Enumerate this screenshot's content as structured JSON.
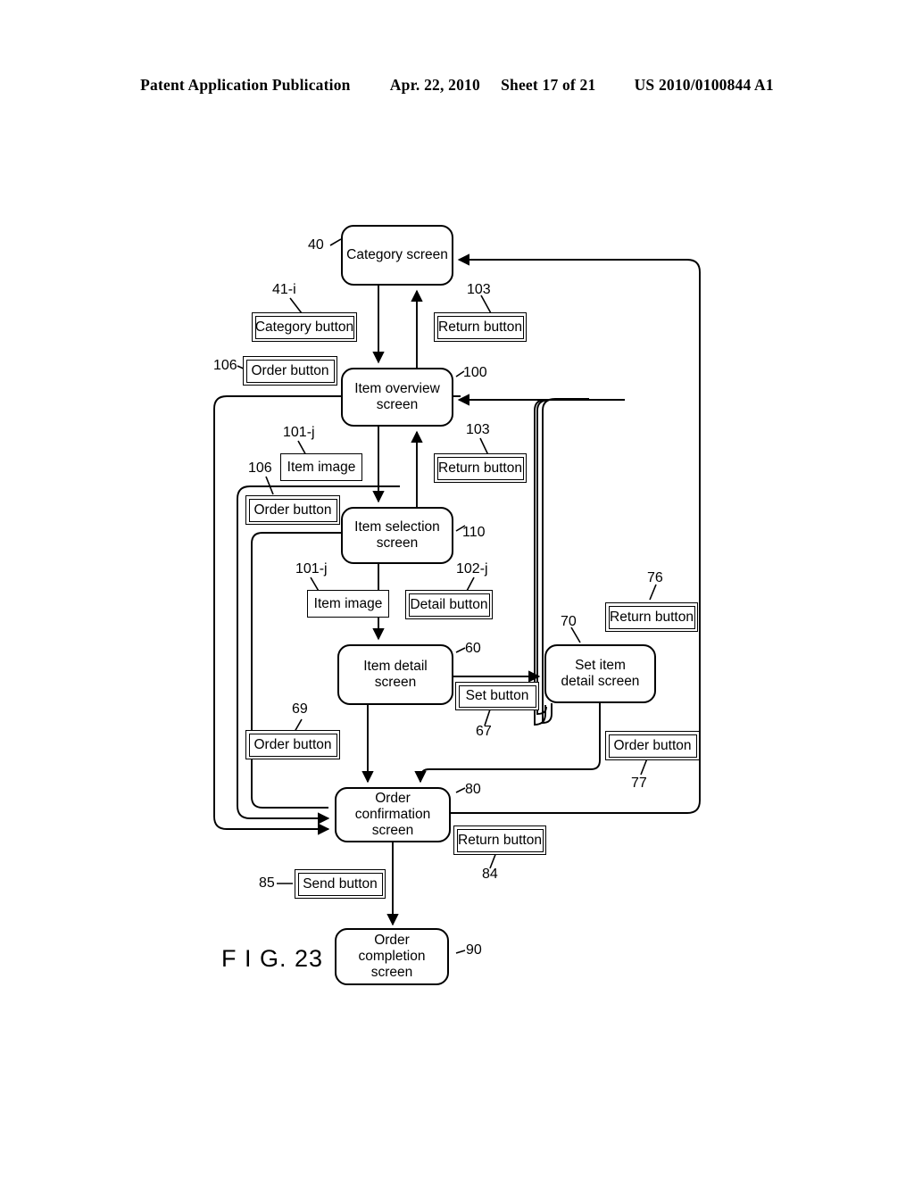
{
  "header": {
    "publication": "Patent Application Publication",
    "date": "Apr. 22, 2010",
    "sheet": "Sheet 17 of 21",
    "docnum": "US 2010/0100844 A1"
  },
  "figure": {
    "caption": "F I G. 23",
    "type": "screen-transition-diagram",
    "nodes": [
      {
        "id": "n40",
        "ref": "40",
        "label": "Category screen"
      },
      {
        "id": "n100",
        "ref": "100",
        "label": "Item overview\nscreen",
        "line1": "Item overview",
        "line2": "screen"
      },
      {
        "id": "n110",
        "ref": "110",
        "label": "Item selection\nscreen",
        "line1": "Item selection",
        "line2": "screen"
      },
      {
        "id": "n60",
        "ref": "60",
        "label": "Item detail screen"
      },
      {
        "id": "n70",
        "ref": "70",
        "label": "Set item\ndetail screen",
        "line1": "Set item",
        "line2": "detail screen"
      },
      {
        "id": "n80",
        "ref": "80",
        "label": "Order confirmation\nscreen",
        "line1": "Order confirmation",
        "line2": "screen"
      },
      {
        "id": "n90",
        "ref": "90",
        "label": "Order completion\nscreen",
        "line1": "Order completion",
        "line2": "screen"
      }
    ],
    "buttons": [
      {
        "id": "b41",
        "ref": "41-i",
        "label": "Category button"
      },
      {
        "id": "b103a",
        "ref": "103",
        "label": "Return button"
      },
      {
        "id": "b106a",
        "ref": "106",
        "label": "Order button"
      },
      {
        "id": "b103b",
        "ref": "103",
        "label": "Return button"
      },
      {
        "id": "b106b",
        "ref": "106",
        "label": "Order button"
      },
      {
        "id": "b102",
        "ref": "102-j",
        "label": "Detail button"
      },
      {
        "id": "b76",
        "ref": "76",
        "label": "Return button"
      },
      {
        "id": "b67",
        "ref": "67",
        "label": "Set button"
      },
      {
        "id": "b69",
        "ref": "69",
        "label": "Order button"
      },
      {
        "id": "b77",
        "ref": "77",
        "label": "Order button"
      },
      {
        "id": "b84",
        "ref": "84",
        "label": "Return button"
      },
      {
        "id": "b85",
        "ref": "85",
        "label": "Send button"
      }
    ],
    "plainboxes": [
      {
        "id": "img101a",
        "ref": "101-j",
        "label": "Item image"
      },
      {
        "id": "img101b",
        "ref": "101-j",
        "label": "Item image"
      }
    ]
  }
}
